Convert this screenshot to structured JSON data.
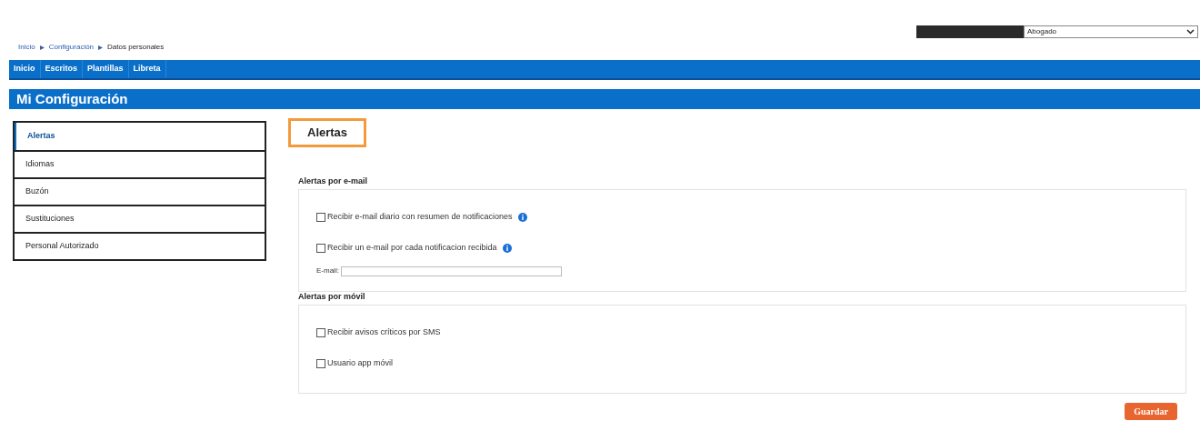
{
  "breadcrumb": [
    {
      "label": "Inicio",
      "link": true
    },
    {
      "label": "Configuración",
      "link": true
    },
    {
      "label": "Datos personales",
      "link": false
    }
  ],
  "role_select": {
    "value": "Abogado"
  },
  "nav": [
    {
      "label": "Inicio"
    },
    {
      "label": "Escritos"
    },
    {
      "label": "Plantillas"
    },
    {
      "label": "Libreta"
    }
  ],
  "page_title": "Mi Configuración",
  "sidebar": {
    "items": [
      {
        "label": "Alertas",
        "selected": true
      },
      {
        "label": "Idiomas",
        "selected": false
      },
      {
        "label": "Buzón",
        "selected": false
      },
      {
        "label": "Sustituciones",
        "selected": false
      },
      {
        "label": "Personal Autorizado",
        "selected": false
      }
    ]
  },
  "section_title": "Alertas",
  "groups": [
    {
      "title": "Alertas por e-mail",
      "options": [
        {
          "label": "Recibir e-mail diario con resumen de notificaciones",
          "checked": false,
          "info": true
        },
        {
          "label": "Recibir un e-mail por cada notificacion recibida",
          "checked": false,
          "info": true
        }
      ],
      "email_label": "E-mail:"
    },
    {
      "title": "Alertas por móvil",
      "options": [
        {
          "label": "Recibir avisos críticos por SMS",
          "checked": false,
          "info": false
        },
        {
          "label": "Usuario app móvil",
          "checked": false,
          "info": false
        }
      ]
    }
  ],
  "save_button": "Guardar"
}
